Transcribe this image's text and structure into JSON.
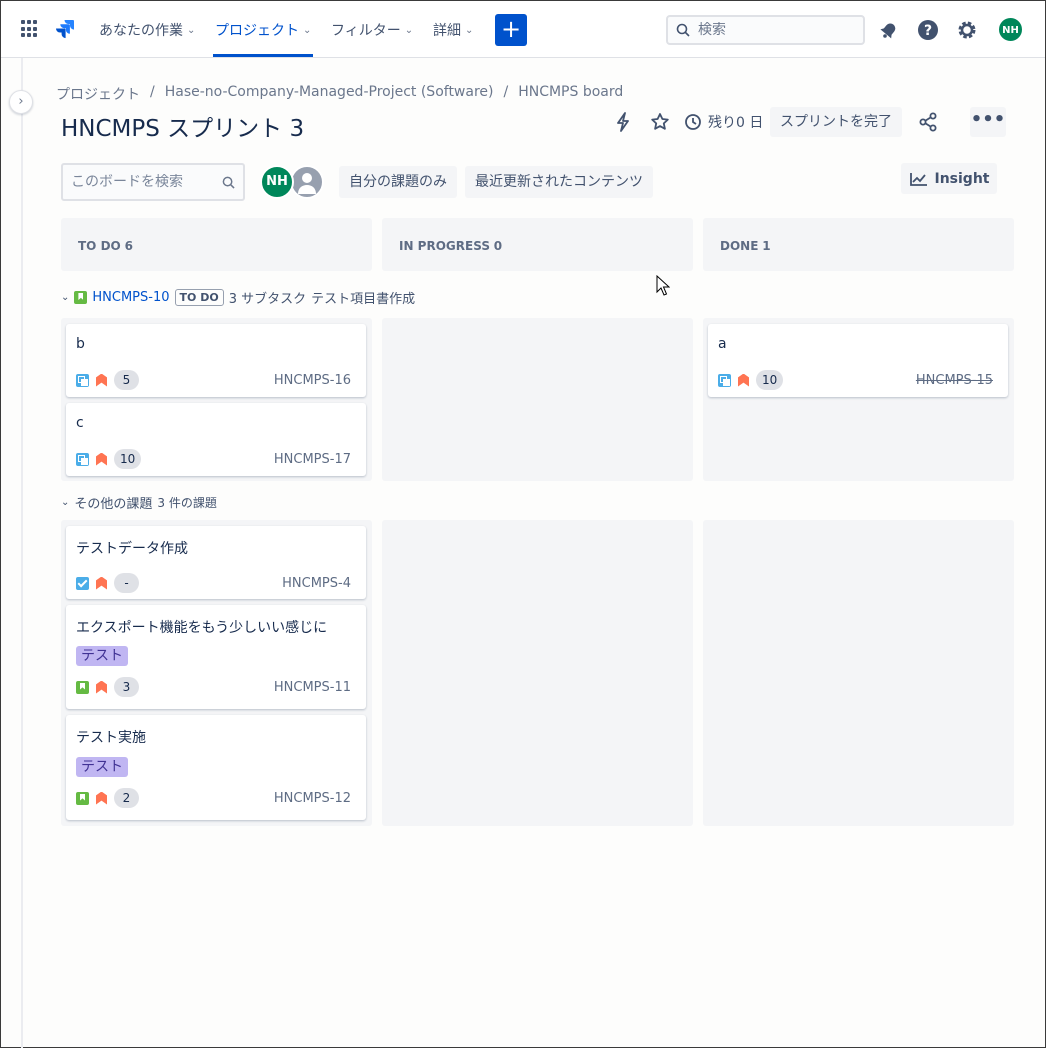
{
  "nav": {
    "items": [
      {
        "label": "あなたの作業"
      },
      {
        "label": "プロジェクト"
      },
      {
        "label": "フィルター"
      },
      {
        "label": "詳細"
      }
    ],
    "create_label": "+",
    "search_placeholder": "検索",
    "user_initials": "NH"
  },
  "breadcrumb": [
    "プロジェクト",
    "Hase-no-Company-Managed-Project (Software)",
    "HNCMPS board"
  ],
  "breadcrumb_sep": "/",
  "header": {
    "title": "HNCMPS スプリント 3",
    "days_left": "残り0 日",
    "complete_label": "スプリントを完了",
    "more_label": "•••"
  },
  "filters": {
    "board_search_placeholder": "このボードを検索",
    "avatar_initials": "NH",
    "only_my_issues": "自分の課題のみ",
    "recently_updated": "最近更新されたコンテンツ",
    "insight": "Insight"
  },
  "columns": [
    {
      "name": "TO DO",
      "count": "6"
    },
    {
      "name": "IN PROGRESS",
      "count": "0"
    },
    {
      "name": "DONE",
      "count": "1"
    }
  ],
  "swimlanes": [
    {
      "key": "HNCMPS-10",
      "status": "TO DO",
      "subtasks": "3 サブタスク",
      "summary": "テスト項目書作成",
      "cards": {
        "todo": [
          {
            "summary": "b",
            "estimate": "5",
            "key": "HNCMPS-16",
            "type": "subtask"
          },
          {
            "summary": "c",
            "estimate": "10",
            "key": "HNCMPS-17",
            "type": "subtask"
          }
        ],
        "done": [
          {
            "summary": "a",
            "estimate": "10",
            "key": "HNCMPS-15",
            "type": "subtask"
          }
        ]
      }
    },
    {
      "title": "その他の課題",
      "count": "3 件の課題",
      "cards": {
        "todo": [
          {
            "summary": "テストデータ作成",
            "estimate": "-",
            "key": "HNCMPS-4",
            "type": "task"
          },
          {
            "summary": "エクスポート機能をもう少しいい感じに",
            "label": "テスト",
            "estimate": "3",
            "key": "HNCMPS-11",
            "type": "story"
          },
          {
            "summary": "テスト実施",
            "label": "テスト",
            "estimate": "2",
            "key": "HNCMPS-12",
            "type": "story"
          }
        ]
      }
    }
  ],
  "colors": {
    "accent": "#0052cc",
    "column_bg": "#f4f5f7",
    "label_bg": "#c0b6f2",
    "priority": "#ff7452",
    "story": "#65ba43",
    "subtask": "#4bade8",
    "avatar": "#00875a"
  }
}
